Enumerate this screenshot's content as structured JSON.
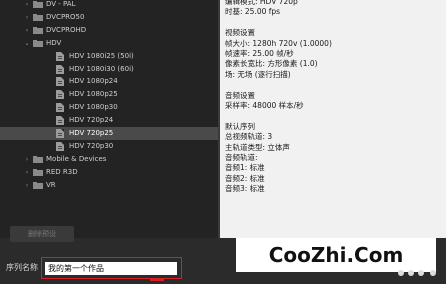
{
  "tree": [
    {
      "kind": "folder",
      "label": "DV - PAL",
      "expanded": false,
      "indent": 1
    },
    {
      "kind": "folder",
      "label": "DVCPRO50",
      "expanded": false,
      "indent": 1
    },
    {
      "kind": "folder",
      "label": "DVCPROHD",
      "expanded": false,
      "indent": 1
    },
    {
      "kind": "folder",
      "label": "HDV",
      "expanded": true,
      "indent": 1
    },
    {
      "kind": "preset",
      "label": "HDV 1080i25 (50i)",
      "indent": 2
    },
    {
      "kind": "preset",
      "label": "HDV 1080i30 (60i)",
      "indent": 2
    },
    {
      "kind": "preset",
      "label": "HDV 1080p24",
      "indent": 2
    },
    {
      "kind": "preset",
      "label": "HDV 1080p25",
      "indent": 2
    },
    {
      "kind": "preset",
      "label": "HDV 1080p30",
      "indent": 2
    },
    {
      "kind": "preset",
      "label": "HDV 720p24",
      "indent": 2
    },
    {
      "kind": "preset",
      "label": "HDV 720p25",
      "indent": 2,
      "selected": true
    },
    {
      "kind": "preset",
      "label": "HDV 720p30",
      "indent": 2
    },
    {
      "kind": "folder",
      "label": "Mobile & Devices",
      "expanded": false,
      "indent": 1
    },
    {
      "kind": "folder",
      "label": "RED R3D",
      "expanded": false,
      "indent": 1
    },
    {
      "kind": "folder",
      "label": "VR",
      "expanded": false,
      "indent": 1
    }
  ],
  "info": {
    "lines": [
      "编辑模式: HDV 720p",
      "时基: 25.00 fps",
      "",
      "视频设置",
      "帧大小: 1280h 720v (1.0000)",
      "帧速率: 25.00 帧/秒",
      "像素长宽比: 方形像素 (1.0)",
      "场: 无场 (逐行扫描)",
      "",
      "音频设置",
      "采样率: 48000 样本/秒",
      "",
      "默认序列",
      "总视频轨道: 3",
      "主轨道类型: 立体声",
      "音频轨道:",
      "音频1: 标准",
      "音频2: 标准",
      "音频3: 标准"
    ]
  },
  "delete_button": {
    "label": "删除预设"
  },
  "sequence_name": {
    "label": "序列名称",
    "value": "我的第一个作品"
  },
  "watermark": {
    "text": "CooZhi.Com"
  },
  "colors": {
    "selection": "#4a4a4a",
    "highlight": "#d42020",
    "info_bg": "#f1f1f1"
  }
}
